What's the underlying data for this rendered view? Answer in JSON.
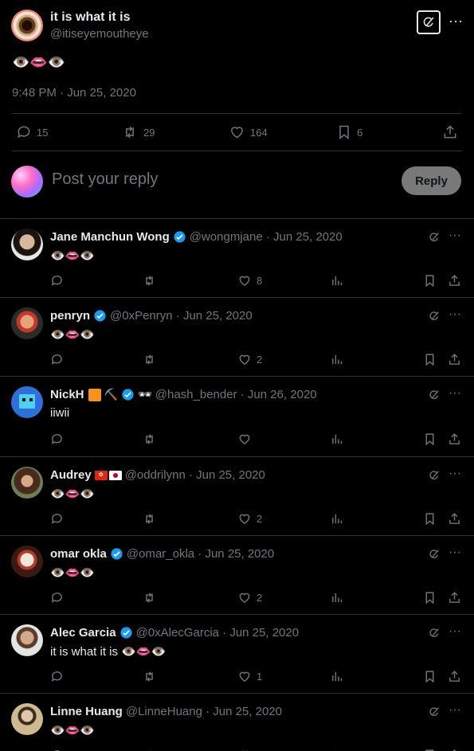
{
  "main_tweet": {
    "name": "it is what it is",
    "handle": "@itiseyemoutheye",
    "text": "👁️👄👁️",
    "timestamp": "9:48 PM · Jun 25, 2020",
    "stats": {
      "replies": "15",
      "reposts": "29",
      "likes": "164",
      "bookmarks": "6"
    }
  },
  "composer": {
    "placeholder": "Post your reply",
    "button_label": "Reply"
  },
  "replies": [
    {
      "name": "Jane Manchun Wong",
      "meta": "@wongmjane · Jun 25, 2020",
      "text": "👁️👄👁️",
      "likes": "8"
    },
    {
      "name": "penryn",
      "meta": "@0xPenryn · Jun 25, 2020",
      "text": "👁️👄👁️",
      "likes": "2"
    },
    {
      "name": "NickH",
      "meta": "@hash_bender · Jun 26, 2020",
      "text": "iiwii",
      "likes": "",
      "badges": [
        "⛏️",
        "🕶"
      ]
    },
    {
      "name": "Audrey",
      "meta": "@oddrilynn · Jun 25, 2020",
      "text": "👁️👄👁️",
      "likes": "2"
    },
    {
      "name": "omar okla",
      "meta": "@omar_okla · Jun 25, 2020",
      "text": "👁️👄👁️",
      "likes": "2"
    },
    {
      "name": "Alec Garcia",
      "meta": "@0xAlecGarcia · Jun 25, 2020",
      "text": "it is what it is 👁️👄👁️",
      "likes": "1"
    },
    {
      "name": "Linne Huang",
      "meta": "@LinneHuang · Jun 25, 2020",
      "text": "👁️👄👁️",
      "likes": ""
    }
  ],
  "icons": {
    "more": "···",
    "accent": "#1d9bf0",
    "muted": "#71767b"
  }
}
